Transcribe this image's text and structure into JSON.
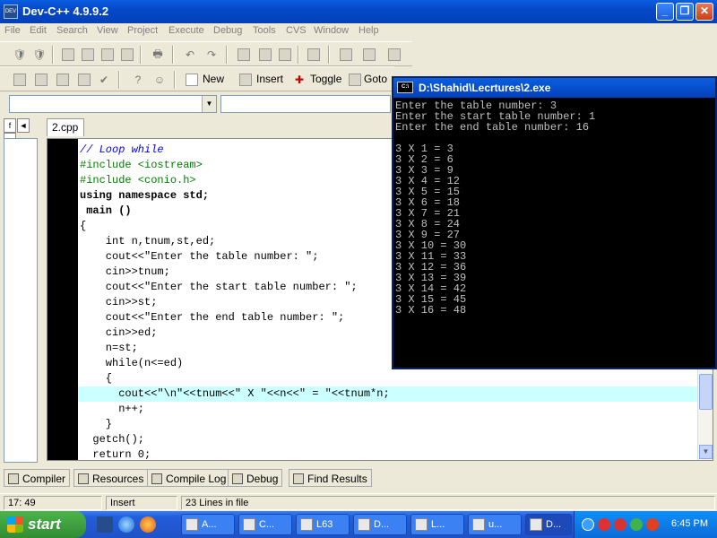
{
  "window": {
    "title": "Dev-C++ 4.9.9.2",
    "app_icon": "DEV"
  },
  "menu": [
    "File",
    "Edit",
    "Search",
    "View",
    "Project",
    "Execute",
    "Debug",
    "Tools",
    "CVS",
    "Window",
    "Help"
  ],
  "toolbar": {
    "new_label": "New",
    "insert_label": "Insert",
    "toggle_label": "Toggle",
    "goto_label": "Goto"
  },
  "editor": {
    "file_tab": "2.cpp",
    "left_tabs": [
      "f",
      "◄",
      "►"
    ]
  },
  "code_lines": [
    "// Loop while",
    "#include <iostream>",
    "#include <conio.h>",
    "using namespace std;",
    " main ()",
    "{",
    "    int n,tnum,st,ed;",
    "    cout<<\"Enter the table number: \";",
    "    cin>>tnum;",
    "    cout<<\"Enter the start table number: \";",
    "    cin>>st;",
    "    cout<<\"Enter the end table number: \";",
    "    cin>>ed;",
    "    n=st;",
    "    while(n<=ed)",
    "    {",
    "      cout<<\"\\n\"<<tnum<<\" X \"<<n<<\" = \"<<tnum*n;",
    "      n++;",
    "    }",
    "  getch();",
    "  return 0;"
  ],
  "bottom_tabs": [
    "Compiler",
    "Resources",
    "Compile Log",
    "Debug",
    "Find Results"
  ],
  "status": {
    "position": "17: 49",
    "mode": "Insert",
    "lines": "23 Lines in file"
  },
  "console": {
    "title": "D:\\Shahid\\Lecrtures\\2.exe",
    "icon": "C:\\",
    "output": "Enter the table number: 3\nEnter the start table number: 1\nEnter the end table number: 16\n\n3 X 1 = 3\n3 X 2 = 6\n3 X 3 = 9\n3 X 4 = 12\n3 X 5 = 15\n3 X 6 = 18\n3 X 7 = 21\n3 X 8 = 24\n3 X 9 = 27\n3 X 10 = 30\n3 X 11 = 33\n3 X 12 = 36\n3 X 13 = 39\n3 X 14 = 42\n3 X 15 = 45\n3 X 16 = 48"
  },
  "taskbar": {
    "start_label": "start",
    "tasks": [
      "A...",
      "C...",
      "L63",
      "D...",
      "L...",
      "u...",
      "D..."
    ],
    "clock": "6:45 PM"
  }
}
